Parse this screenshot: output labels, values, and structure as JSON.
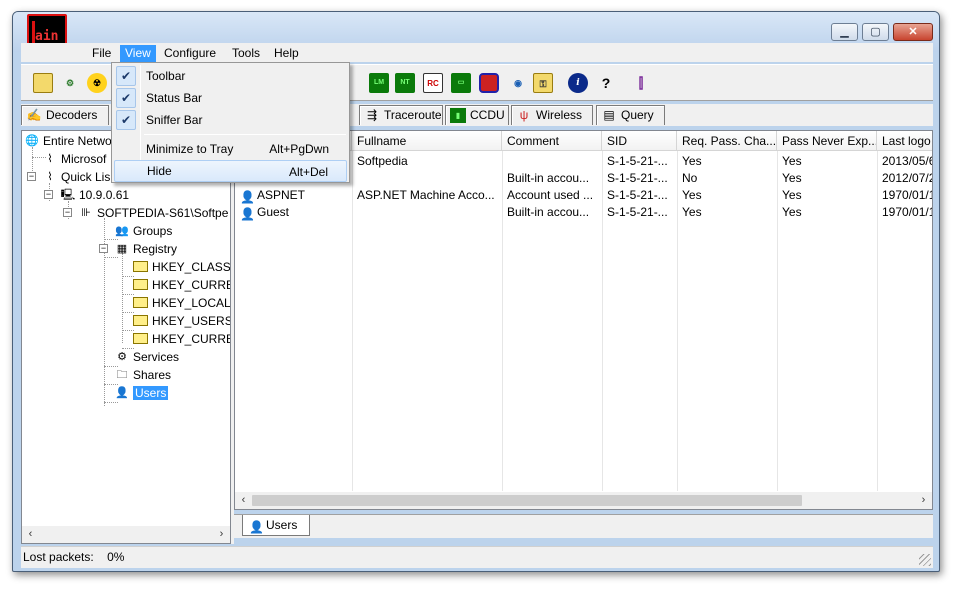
{
  "app": {
    "logo_text": "ain"
  },
  "menubar": {
    "items": [
      {
        "label": "File"
      },
      {
        "label": "View"
      },
      {
        "label": "Configure"
      },
      {
        "label": "Tools"
      },
      {
        "label": "Help"
      }
    ]
  },
  "view_menu": {
    "items": [
      {
        "label": "Toolbar",
        "checked": true,
        "shortcut": ""
      },
      {
        "label": "Status Bar",
        "checked": true,
        "shortcut": ""
      },
      {
        "label": "Sniffer Bar",
        "checked": true,
        "shortcut": ""
      },
      {
        "label": "Minimize to Tray",
        "checked": false,
        "shortcut": "Alt+PgDwn"
      },
      {
        "label": "Hide",
        "checked": false,
        "shortcut": "Alt+Del"
      }
    ]
  },
  "tabs": [
    {
      "label": "Decoders"
    },
    {
      "label": "Traceroute"
    },
    {
      "label": "CCDU"
    },
    {
      "label": "Wireless"
    },
    {
      "label": "Query"
    }
  ],
  "tree": {
    "nodes": [
      {
        "label": "Entire Netwo"
      },
      {
        "label": "Microsof"
      },
      {
        "label": "Quick Lis"
      },
      {
        "label": "10.9.0.61"
      },
      {
        "label": "SOFTPEDIA-S61\\Softpe"
      },
      {
        "label": "Groups"
      },
      {
        "label": "Registry"
      },
      {
        "label": "HKEY_CLASSES_"
      },
      {
        "label": "HKEY_CURRENT"
      },
      {
        "label": "HKEY_LOCAL_M"
      },
      {
        "label": "HKEY_USERS"
      },
      {
        "label": "HKEY_CURRENT"
      },
      {
        "label": "Services"
      },
      {
        "label": "Shares"
      },
      {
        "label": "Users"
      }
    ]
  },
  "table": {
    "columns": [
      "Fullname",
      "Comment",
      "SID",
      "Req. Pass. Cha...",
      "Pass Never Exp...",
      "Last logo"
    ],
    "rows": [
      {
        "name": "",
        "fullname": "Softpedia",
        "comment": "",
        "sid": "S-1-5-21-...",
        "req": "Yes",
        "never": "Yes",
        "last": "2013/05/6"
      },
      {
        "name": "",
        "fullname": "",
        "comment": "Built-in accou...",
        "sid": "S-1-5-21-...",
        "req": "No",
        "never": "Yes",
        "last": "2012/07/2"
      },
      {
        "name": "ASPNET",
        "fullname": "ASP.NET Machine Acco...",
        "comment": "Account used ...",
        "sid": "S-1-5-21-...",
        "req": "Yes",
        "never": "Yes",
        "last": "1970/01/1"
      },
      {
        "name": "Guest",
        "fullname": "",
        "comment": "Built-in accou...",
        "sid": "S-1-5-21-...",
        "req": "Yes",
        "never": "Yes",
        "last": "1970/01/1"
      }
    ]
  },
  "bottom_tab": {
    "label": "Users"
  },
  "status": {
    "label": "Lost packets:",
    "value": "0%"
  }
}
